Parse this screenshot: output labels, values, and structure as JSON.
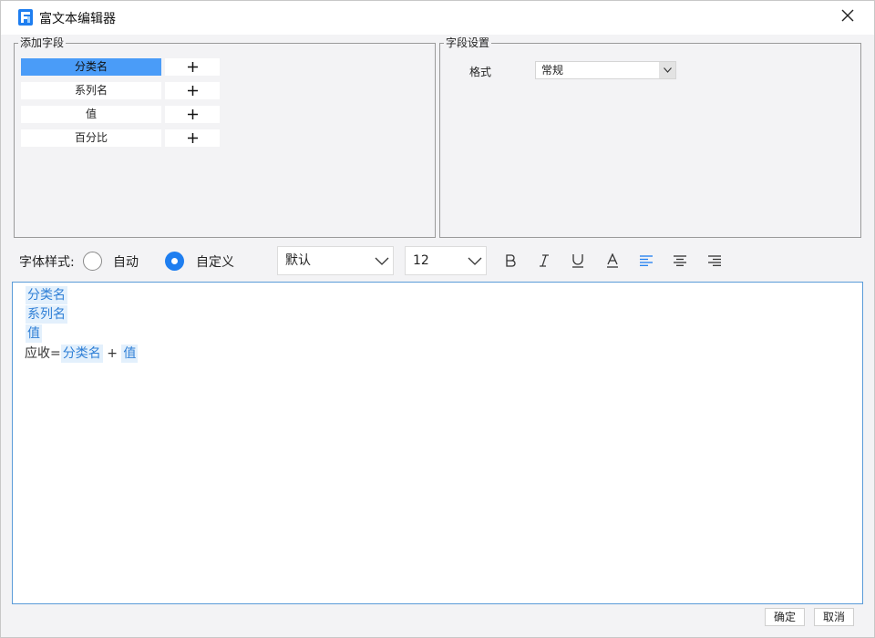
{
  "window": {
    "title": "富文本编辑器",
    "close_icon": "close-icon",
    "app_icon": "fine-report-logo-icon"
  },
  "add_field_panel": {
    "legend": "添加字段",
    "fields": [
      {
        "label": "分类名",
        "selected": true,
        "add_icon": "plus-icon"
      },
      {
        "label": "系列名",
        "selected": false,
        "add_icon": "plus-icon"
      },
      {
        "label": "值",
        "selected": false,
        "add_icon": "plus-icon"
      },
      {
        "label": "百分比",
        "selected": false,
        "add_icon": "plus-icon"
      }
    ]
  },
  "field_settings_panel": {
    "legend": "字段设置",
    "format_label": "格式",
    "format_value": "常规"
  },
  "font_toolbar": {
    "label": "字体样式:",
    "radio_auto": "自动",
    "radio_custom": "自定义",
    "selected_radio": "custom",
    "font_family": "默认",
    "font_size": "12",
    "icons": [
      "bold-icon",
      "italic-icon",
      "underline-icon",
      "font-color-icon",
      "align-left-icon",
      "align-center-icon",
      "align-right-icon"
    ],
    "active_align": "align-left"
  },
  "editor": {
    "lines": [
      {
        "chip": "分类名"
      },
      {
        "chip": "系列名"
      },
      {
        "chip": "值"
      },
      {
        "prefix": "应收=",
        "chip1": "分类名",
        "op": "+",
        "chip2": "值"
      }
    ]
  },
  "footer": {
    "ok_label": "确定",
    "cancel_label": "取消"
  },
  "colors": {
    "accent": "#1e7ef0",
    "selected_field": "#4a9cf8",
    "chip_bg": "#e3f0fc",
    "chip_text": "#2f7fd6"
  }
}
